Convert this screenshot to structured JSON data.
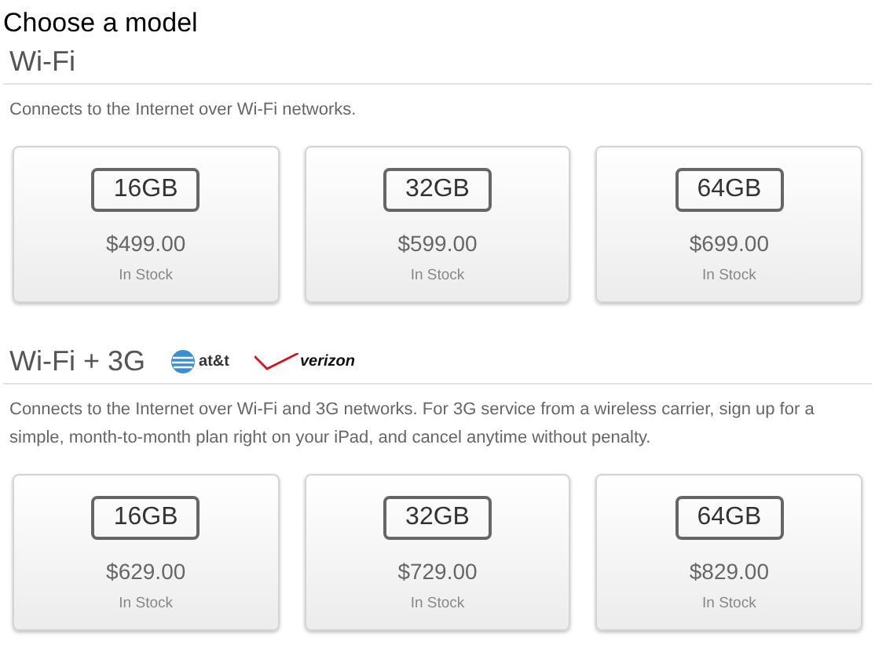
{
  "title": "Choose a model",
  "sections": [
    {
      "heading": "Wi-Fi",
      "description": "Connects to the Internet over Wi-Fi networks.",
      "models": [
        {
          "capacity": "16GB",
          "price": "$499.00",
          "availability": "In Stock"
        },
        {
          "capacity": "32GB",
          "price": "$599.00",
          "availability": "In Stock"
        },
        {
          "capacity": "64GB",
          "price": "$699.00",
          "availability": "In Stock"
        }
      ]
    },
    {
      "heading": "Wi-Fi + 3G",
      "carriers": [
        {
          "kind": "globe",
          "name": "at&t"
        },
        {
          "kind": "check",
          "name": "verizon"
        }
      ],
      "description": "Connects to the Internet over Wi-Fi and 3G networks. For 3G service from a wireless carrier, sign up for a simple, month-to-month plan right on your iPad, and cancel anytime without penalty.",
      "models": [
        {
          "capacity": "16GB",
          "price": "$629.00",
          "availability": "In Stock"
        },
        {
          "capacity": "32GB",
          "price": "$729.00",
          "availability": "In Stock"
        },
        {
          "capacity": "64GB",
          "price": "$829.00",
          "availability": "In Stock"
        }
      ]
    }
  ]
}
